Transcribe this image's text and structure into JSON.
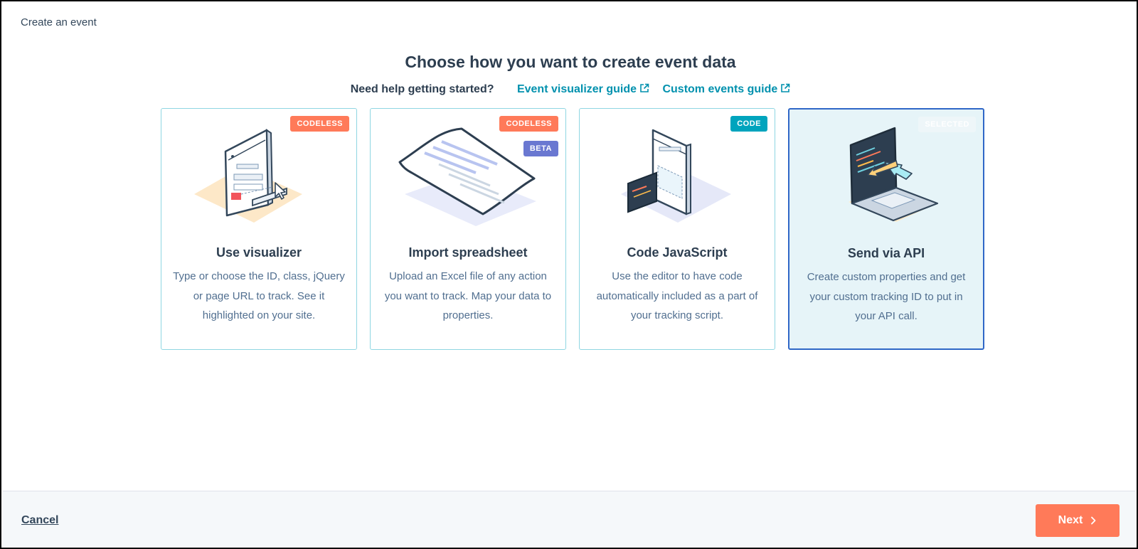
{
  "page": {
    "title": "Create an event"
  },
  "header": {
    "heading": "Choose how you want to create event data",
    "help_label": "Need help getting started?",
    "links": [
      {
        "label": "Event visualizer guide",
        "icon": "external-link-icon"
      },
      {
        "label": "Custom events guide",
        "icon": "external-link-icon"
      }
    ]
  },
  "cards": [
    {
      "title": "Use visualizer",
      "badge": "CODELESS",
      "description": "Type or choose the ID, class, jQuery or page URL to track. See it highlighted on your site.",
      "icon": "visualizer-illustration"
    },
    {
      "title": "Import spreadsheet",
      "badge": "CODELESS",
      "badge2": "BETA",
      "description": "Upload an Excel file of any action you want to track. Map your data to properties.",
      "icon": "spreadsheet-illustration"
    },
    {
      "title": "Code JavaScript",
      "badge": "CODE",
      "description": "Use the editor to have code automatically included as a part of your tracking script.",
      "icon": "javascript-illustration"
    },
    {
      "title": "Send via API",
      "badge": "SELECTED",
      "description": "Create custom properties and get your custom tracking ID to put in your API call.",
      "icon": "api-laptop-illustration",
      "selected": true
    }
  ],
  "footer": {
    "cancel_label": "Cancel",
    "next_label": "Next"
  },
  "colors": {
    "accent": "#ff7a59",
    "link": "#0091ae",
    "selected_border": "#2f67c7",
    "card_border": "#8fd6e2"
  }
}
